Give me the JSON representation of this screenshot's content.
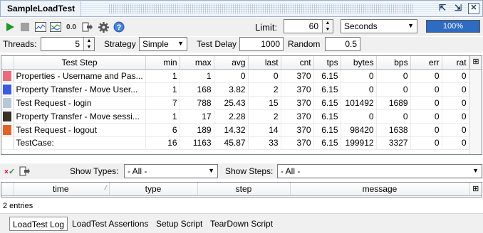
{
  "window": {
    "title": "SampleLoadTest",
    "buttons": [
      {
        "name": "minimize-icon",
        "glyph": "⇱"
      },
      {
        "name": "restore-icon",
        "glyph": "⇲"
      },
      {
        "name": "close-icon",
        "glyph": "✕"
      }
    ]
  },
  "toolbar": {
    "limit_label": "Limit:",
    "limit_value": "60",
    "limit_unit": "Seconds",
    "progress_text": "100%",
    "progress_fraction": 1.0,
    "icons": [
      "run-icon",
      "stop-icon",
      "statistics-graph-icon",
      "statistics-history-icon",
      "reset-icon",
      "export-icon",
      "options-icon",
      "help-icon"
    ],
    "reset_label": "0.0",
    "help_label": "?"
  },
  "settings": {
    "threads_label": "Threads:",
    "threads_value": "5",
    "strategy_label": "Strategy",
    "strategy_value": "Simple",
    "delay_label": "Test Delay",
    "delay_value": "1000",
    "random_label": "Random",
    "random_value": "0.5"
  },
  "stats": {
    "columns": [
      "Test Step",
      "min",
      "max",
      "avg",
      "last",
      "cnt",
      "tps",
      "bytes",
      "bps",
      "err",
      "rat"
    ],
    "rows": [
      {
        "color": "#e96b7b",
        "cells": [
          "Properties - Username and Pas...",
          "1",
          "1",
          "0",
          "0",
          "370",
          "6.15",
          "0",
          "0",
          "0",
          "0"
        ]
      },
      {
        "color": "#3c5ce0",
        "cells": [
          "Property Transfer - Move User...",
          "1",
          "168",
          "3.82",
          "2",
          "370",
          "6.15",
          "0",
          "0",
          "0",
          "0"
        ]
      },
      {
        "color": "#b8c7d9",
        "cells": [
          "Test Request - login",
          "7",
          "788",
          "25.43",
          "15",
          "370",
          "6.15",
          "101492",
          "1689",
          "0",
          "0"
        ]
      },
      {
        "color": "#3b3026",
        "cells": [
          "Property Transfer - Move sessi...",
          "1",
          "17",
          "2.28",
          "2",
          "370",
          "6.15",
          "0",
          "0",
          "0",
          "0"
        ]
      },
      {
        "color": "#e06428",
        "cells": [
          "Test Request - logout",
          "6",
          "189",
          "14.32",
          "14",
          "370",
          "6.15",
          "98420",
          "1638",
          "0",
          "0"
        ]
      },
      {
        "color": "",
        "cells": [
          "TestCase:",
          "16",
          "1163",
          "45.87",
          "33",
          "370",
          "6.15",
          "199912",
          "3327",
          "0",
          "0"
        ]
      }
    ]
  },
  "log": {
    "show_types_label": "Show Types:",
    "show_types_value": "- All -",
    "show_steps_label": "Show Steps:",
    "show_steps_value": "- All -",
    "columns": [
      "time",
      "type",
      "step",
      "message"
    ],
    "entries_text": "2 entries"
  },
  "tabs": [
    {
      "label": "LoadTest Log",
      "active": true
    },
    {
      "label": "LoadTest Assertions",
      "active": false
    },
    {
      "label": "Setup Script",
      "active": false
    },
    {
      "label": "TearDown Script",
      "active": false
    }
  ]
}
